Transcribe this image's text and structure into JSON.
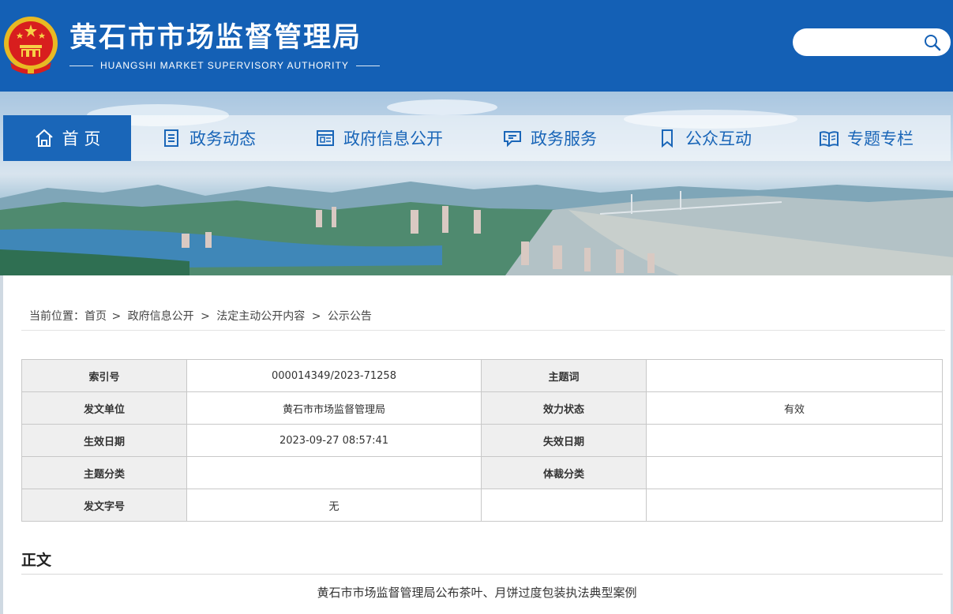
{
  "header": {
    "title_cn": "黄石市市场监督管理局",
    "title_en": "HUANGSHI MARKET SUPERVISORY AUTHORITY",
    "emblem_icon": "national-emblem-icon",
    "search_icon": "search-icon",
    "search_placeholder": ""
  },
  "nav": {
    "items": [
      {
        "label": "首 页",
        "icon": "home-icon",
        "active": true
      },
      {
        "label": "政务动态",
        "icon": "document-list-icon"
      },
      {
        "label": "政府信息公开",
        "icon": "newspaper-icon"
      },
      {
        "label": "政务服务",
        "icon": "chat-icon"
      },
      {
        "label": "公众互动",
        "icon": "bookmark-icon"
      },
      {
        "label": "专题专栏",
        "icon": "open-book-icon"
      }
    ]
  },
  "breadcrumb": {
    "prefix": "当前位置：",
    "items": [
      "首页",
      "政府信息公开",
      "法定主动公开内容",
      "公示公告"
    ],
    "separator": ">"
  },
  "meta_table": {
    "rows": [
      {
        "l1": "索引号",
        "v1": "000014349/2023-71258",
        "l2": "主题词",
        "v2": ""
      },
      {
        "l1": "发文单位",
        "v1": "黄石市市场监督管理局",
        "l2": "效力状态",
        "v2": "有效"
      },
      {
        "l1": "生效日期",
        "v1": "2023-09-27 08:57:41",
        "l2": "失效日期",
        "v2": ""
      },
      {
        "l1": "主题分类",
        "v1": "",
        "l2": "体裁分类",
        "v2": ""
      },
      {
        "l1": "发文字号",
        "v1": "无",
        "l2": "",
        "v2": ""
      }
    ]
  },
  "body": {
    "section_title": "正文",
    "doc_title": "黄石市市场监督管理局公布茶叶、月饼过度包装执法典型案例"
  },
  "colors": {
    "brand_blue": "#1460b5",
    "nav_active": "#1a66b8",
    "table_label_bg": "#efefef"
  }
}
